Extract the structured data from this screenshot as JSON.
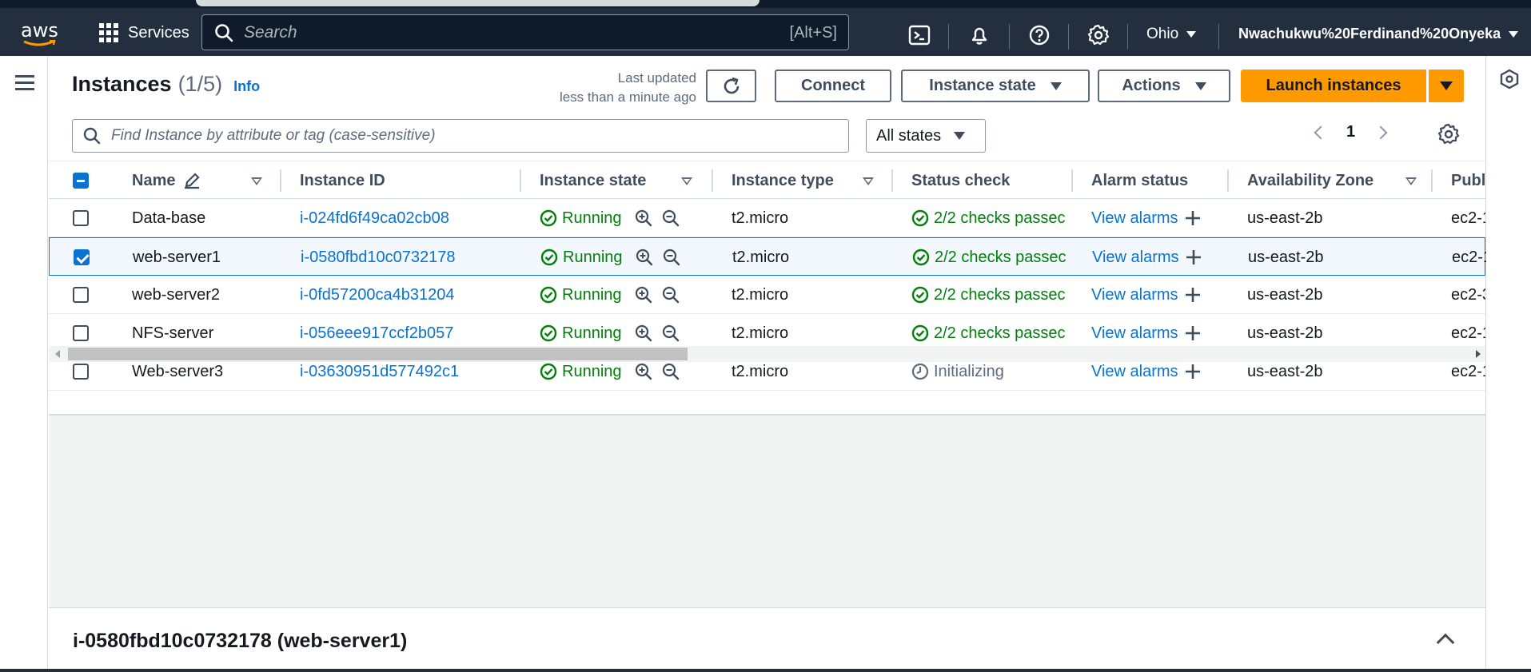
{
  "nav": {
    "logo_text": "aws",
    "services_label": "Services",
    "search_placeholder": "Search",
    "search_shortcut": "[Alt+S]",
    "region": "Ohio",
    "account": "Nwachukwu%20Ferdinand%20Onyeka"
  },
  "header": {
    "title": "Instances",
    "count": "(1/5)",
    "info": "Info",
    "updated_line1": "Last updated",
    "updated_line2": "less than a minute ago",
    "connect": "Connect",
    "instance_state": "Instance state",
    "actions": "Actions",
    "launch": "Launch instances"
  },
  "filter": {
    "placeholder": "Find Instance by attribute or tag (case-sensitive)",
    "states": "All states",
    "page": "1"
  },
  "columns": {
    "name": "Name",
    "id": "Instance ID",
    "state": "Instance state",
    "type": "Instance type",
    "status": "Status check",
    "alarm": "Alarm status",
    "az": "Availability Zone",
    "public": "Publ"
  },
  "rows": [
    {
      "name": "Data-base",
      "id": "i-024fd6f49ca02cb08",
      "state": "Running",
      "type": "t2.micro",
      "status": "2/2 checks passec",
      "alarm": "View alarms",
      "az": "us-east-2b",
      "public": "ec2-1",
      "selected": false
    },
    {
      "name": "web-server1",
      "id": "i-0580fbd10c0732178",
      "state": "Running",
      "type": "t2.micro",
      "status": "2/2 checks passec",
      "alarm": "View alarms",
      "az": "us-east-2b",
      "public": "ec2-1",
      "selected": true
    },
    {
      "name": "web-server2",
      "id": "i-0fd57200ca4b31204",
      "state": "Running",
      "type": "t2.micro",
      "status": "2/2 checks passec",
      "alarm": "View alarms",
      "az": "us-east-2b",
      "public": "ec2-3",
      "selected": false
    },
    {
      "name": "NFS-server",
      "id": "i-056eee917ccf2b057",
      "state": "Running",
      "type": "t2.micro",
      "status": "2/2 checks passec",
      "alarm": "View alarms",
      "az": "us-east-2b",
      "public": "ec2-1",
      "selected": false
    },
    {
      "name": "Web-server3",
      "id": "i-03630951d577492c1",
      "state": "Running",
      "type": "t2.micro",
      "status": "Initializing",
      "alarm": "View alarms",
      "az": "us-east-2b",
      "public": "ec2-1",
      "selected": false
    }
  ],
  "detail": {
    "title": "i-0580fbd10c0732178 (web-server1)"
  },
  "colors": {
    "nav_bg": "#232f3e",
    "accent": "#ff9900",
    "link": "#0972d3",
    "success": "#037f0c"
  }
}
